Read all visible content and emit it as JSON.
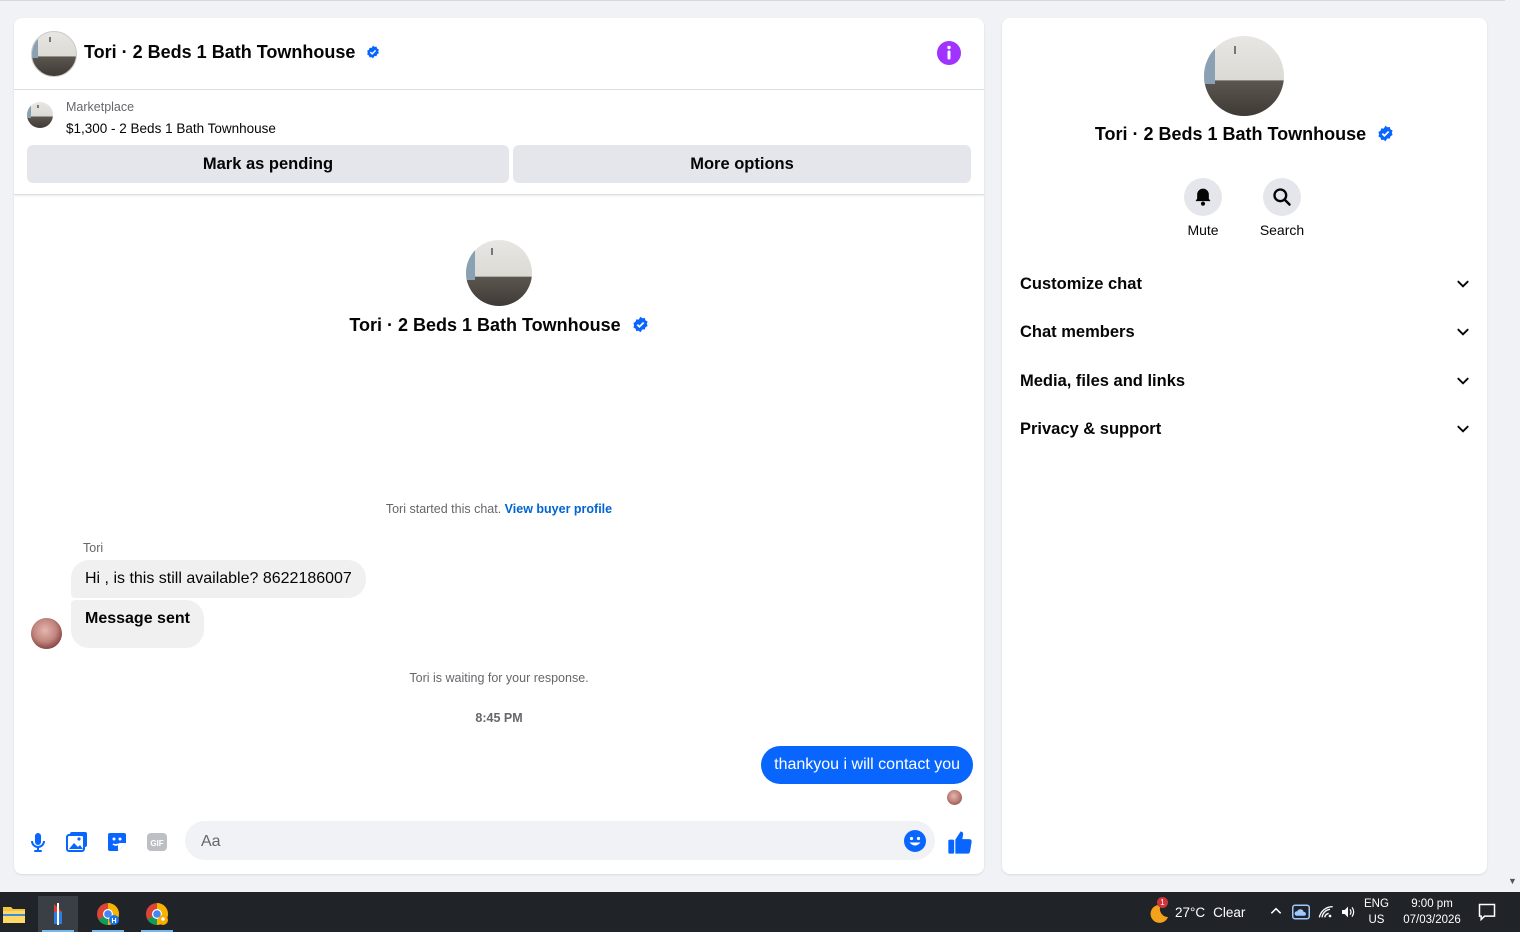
{
  "chat": {
    "title": "Tori · 2 Beds 1 Bath Townhouse",
    "marketplace_label": "Marketplace",
    "listing_title": "$1,300 - 2 Beds 1 Bath Townhouse",
    "mark_pending_label": "Mark as pending",
    "more_options_label": "More options",
    "intro_title": "Tori · 2 Beds 1 Bath Townhouse",
    "started_text": "Tori started this chat.",
    "view_buyer_profile": "View buyer profile",
    "sender_name": "Tori",
    "messages_in": [
      "Hi , is this still available?  8622186007",
      "Message sent"
    ],
    "waiting_text": "Tori is waiting for your response.",
    "timestamp": "8:45 PM",
    "message_out": "thankyou i  will contact you",
    "composer_placeholder": "Aa"
  },
  "side": {
    "title": "Tori · 2 Beds 1 Bath Townhouse",
    "mute_label": "Mute",
    "search_label": "Search",
    "sections": [
      "Customize chat",
      "Chat members",
      "Media, files and links",
      "Privacy & support"
    ]
  },
  "taskbar": {
    "weather_temp": "27°C",
    "weather_cond": "Clear",
    "weather_badge": "1",
    "lang_top": "ENG",
    "lang_bottom": "US",
    "time": "9:00 pm",
    "date": "07/03/2026"
  },
  "colors": {
    "accent": "#0866ff",
    "info_purple": "#a033ff",
    "verified": "#0866ff",
    "taskbar_bg": "#202328"
  },
  "icons": [
    "info-icon",
    "verified-icon",
    "microphone-icon",
    "photo-icon",
    "sticker-icon",
    "gif-icon",
    "emoji-icon",
    "thumbs-up-icon",
    "bell-icon",
    "search-icon",
    "chevron-down-icon",
    "file-explorer-icon",
    "app-icon",
    "chrome-icon",
    "weather-icon",
    "chevron-up-icon",
    "onedrive-icon",
    "wifi-icon",
    "volume-icon",
    "notification-icon"
  ]
}
